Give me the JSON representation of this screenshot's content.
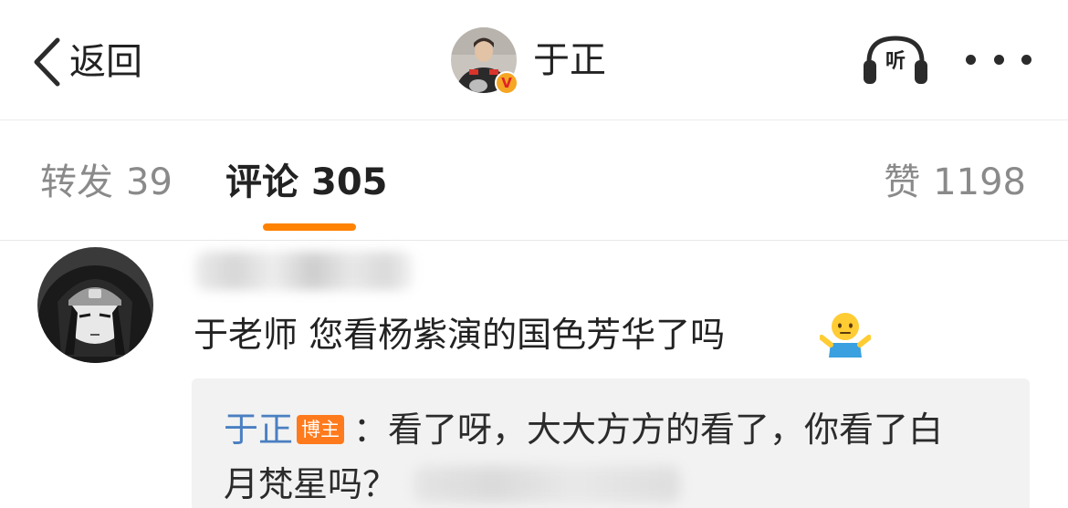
{
  "header": {
    "back_label": "返回",
    "author_name": "于正",
    "verified_badge": "V",
    "listen_label": "听",
    "icons": {
      "back": "chevron-left-icon",
      "listen": "headphones-icon",
      "more": "more-dots-icon"
    }
  },
  "tabs": [
    {
      "label": "转发",
      "count": "39",
      "active": false
    },
    {
      "label": "评论",
      "count": "305",
      "active": true
    },
    {
      "label": "赞",
      "count": "1198",
      "active": false
    }
  ],
  "comment": {
    "username_blurred": true,
    "text": "于老师 您看杨紫演的国色芳华了吗",
    "emoji": "shrug-emoji",
    "reply": {
      "author": "于正",
      "badge": "博主",
      "line1": "：看了呀，大大方方的看了，你看了白",
      "line2": "月梵星吗？",
      "tail_blurred": true
    }
  },
  "colors": {
    "accent": "#ff8200",
    "link": "#4a7fc1",
    "badge": "#ff7a1c",
    "reply_bg": "#f2f2f2",
    "text": "#222222",
    "muted": "#8a8a8a"
  }
}
